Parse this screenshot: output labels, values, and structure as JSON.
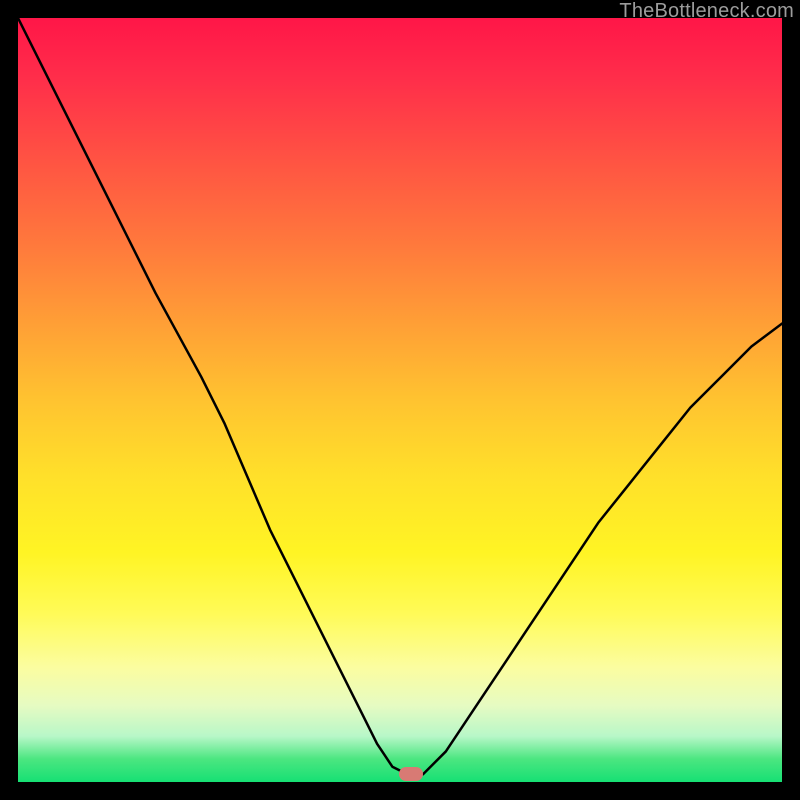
{
  "watermark": "TheBottleneck.com",
  "marker": {
    "x_pct": 51.5,
    "y_pct": 99.0,
    "color": "#d87a74"
  },
  "chart_data": {
    "type": "line",
    "title": "",
    "xlabel": "",
    "ylabel": "",
    "xlim": [
      0,
      100
    ],
    "ylim": [
      0,
      100
    ],
    "grid": false,
    "legend": false,
    "series": [
      {
        "name": "bottleneck-curve",
        "x": [
          0,
          6,
          12,
          18,
          24,
          27,
          30,
          33,
          36,
          39,
          42,
          45,
          47,
          49,
          51,
          53,
          56,
          60,
          64,
          68,
          72,
          76,
          80,
          84,
          88,
          92,
          96,
          100
        ],
        "values": [
          100,
          88,
          76,
          64,
          53,
          47,
          40,
          33,
          27,
          21,
          15,
          9,
          5,
          2,
          1,
          1,
          4,
          10,
          16,
          22,
          28,
          34,
          39,
          44,
          49,
          53,
          57,
          60
        ]
      }
    ],
    "background_gradient_stops": [
      {
        "pos": 0,
        "color": "#ff1648"
      },
      {
        "pos": 20,
        "color": "#ff5842"
      },
      {
        "pos": 40,
        "color": "#ff9f36"
      },
      {
        "pos": 60,
        "color": "#ffe02a"
      },
      {
        "pos": 80,
        "color": "#fffb58"
      },
      {
        "pos": 94,
        "color": "#b8f7c8"
      },
      {
        "pos": 100,
        "color": "#16e074"
      }
    ]
  }
}
